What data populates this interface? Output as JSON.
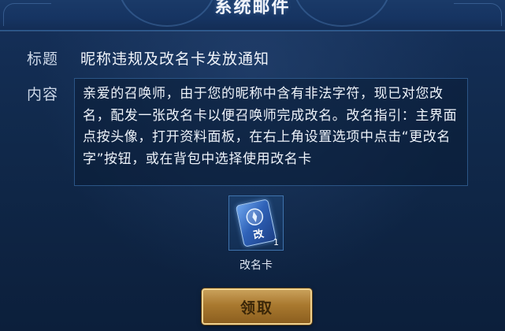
{
  "dialog": {
    "title": "系统邮件"
  },
  "mail": {
    "subject_label": "标题",
    "subject": "昵称违规及改名卡发放通知",
    "content_label": "内容",
    "content": "亲爱的召唤师，由于您的昵称中含有非法字符，现已对您改名，配发一张改名卡以便召唤师完成改名。改名指引：主界面点按头像，打开资料面板，在右上角设置选项中点击“更改名字”按钮，或在背包中选择使用改名卡"
  },
  "attachment": {
    "icon": "rename-card-icon",
    "card_glyph": "改",
    "count": "1",
    "name": "改名卡"
  },
  "actions": {
    "claim_label": "领取"
  },
  "colors": {
    "background": "#0f2340",
    "border": "#2b5586",
    "button_gold": "#c9a05a"
  }
}
